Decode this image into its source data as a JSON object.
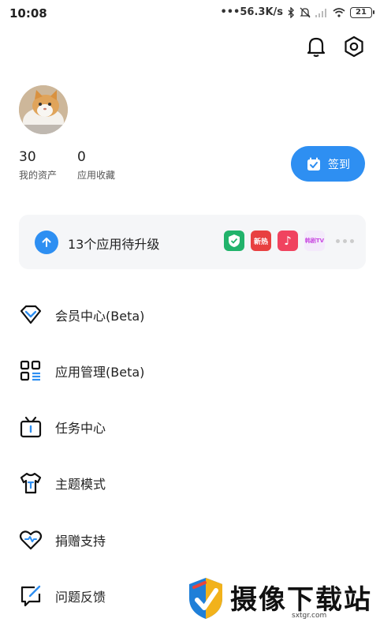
{
  "status_bar": {
    "time": "10:08",
    "network_speed": "•••56.3K/s",
    "battery": "21"
  },
  "profile": {
    "assets_count": "30",
    "assets_label": "我的资产",
    "favorites_count": "0",
    "favorites_label": "应用收藏",
    "checkin_label": "签到"
  },
  "upgrade": {
    "text": "13个应用待升级",
    "apps": [
      {
        "icon": "shield-app-icon",
        "label": "",
        "color": "#21b36b"
      },
      {
        "icon": "news-app-icon",
        "label": "新热",
        "color": "#e84040"
      },
      {
        "icon": "tiktok-app-icon",
        "label": "♪",
        "color": "#f0435f"
      },
      {
        "icon": "tv-app-icon",
        "label": "韩剧TV",
        "color": "#c94be0"
      }
    ]
  },
  "menu": {
    "items": [
      {
        "label": "会员中心(Beta)",
        "icon": "diamond-icon"
      },
      {
        "label": "应用管理(Beta)",
        "icon": "apps-grid-icon"
      },
      {
        "label": "任务中心",
        "icon": "gift-box-icon"
      },
      {
        "label": "主题模式",
        "icon": "tshirt-icon"
      },
      {
        "label": "捐赠支持",
        "icon": "heart-icon"
      },
      {
        "label": "问题反馈",
        "icon": "feedback-edit-icon"
      }
    ]
  },
  "watermark": {
    "title": "摄像下载站",
    "url": "sxtgr.com"
  },
  "colors": {
    "accent": "#2e8ff2",
    "card_bg": "#f5f6f8"
  }
}
